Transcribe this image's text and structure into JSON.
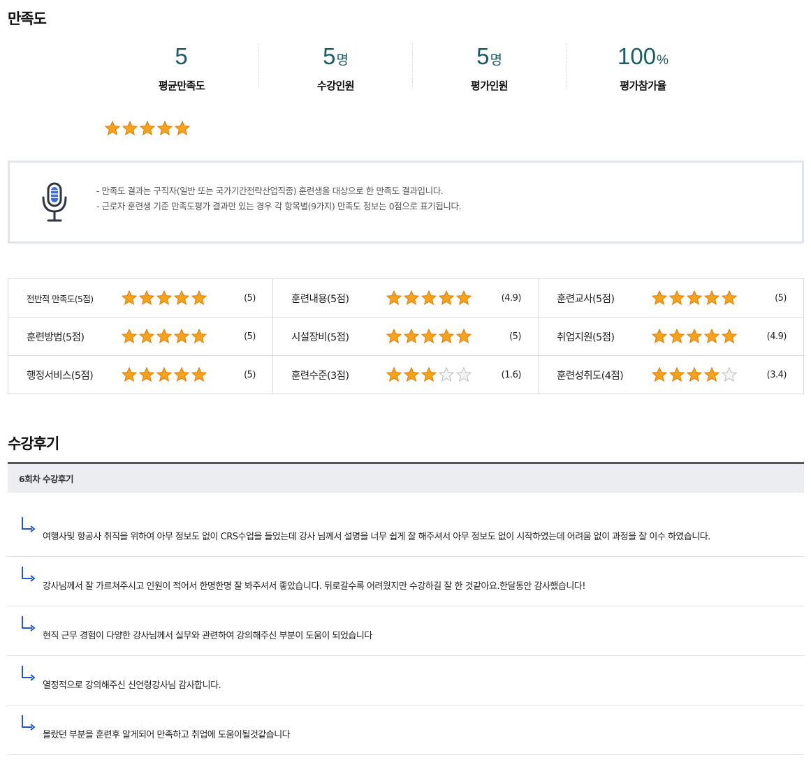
{
  "satisfaction": {
    "title": "만족도",
    "summary": [
      {
        "value": "5",
        "unit": "",
        "label": "평균만족도"
      },
      {
        "value": "5",
        "unit": "명",
        "label": "수강인원"
      },
      {
        "value": "5",
        "unit": "명",
        "label": "평가인원"
      },
      {
        "value": "100",
        "unit": "%",
        "label": "평가참가율"
      }
    ],
    "overall_stars": 5
  },
  "notice": {
    "icon": "microphone-icon",
    "lines": [
      "- 만족도 결과는 구직자(일반 또는 국가기간전략산업직종) 훈련생을 대상으로 한 만족도 결과입니다.",
      "- 근로자 훈련생 기준 만족도평가 결과만 있는 경우 각 항목별(9가지) 만족도 정보는 0점으로 표기됩니다."
    ]
  },
  "ratings": [
    {
      "label": "전반적 만족도(5점)",
      "max": 5,
      "score": 5,
      "score_text": "(5)"
    },
    {
      "label": "훈련내용(5점)",
      "max": 5,
      "score": 4.9,
      "score_text": "(4.9)"
    },
    {
      "label": "훈련교사(5점)",
      "max": 5,
      "score": 5,
      "score_text": "(5)"
    },
    {
      "label": "훈련방법(5점)",
      "max": 5,
      "score": 5,
      "score_text": "(5)"
    },
    {
      "label": "시설장비(5점)",
      "max": 5,
      "score": 5,
      "score_text": "(5)"
    },
    {
      "label": "취업지원(5점)",
      "max": 5,
      "score": 4.9,
      "score_text": "(4.9)"
    },
    {
      "label": "행정서비스(5점)",
      "max": 5,
      "score": 5,
      "score_text": "(5)"
    },
    {
      "label": "훈련수준(3점)",
      "max": 3,
      "score": 1.6,
      "score_text": "(1.6)"
    },
    {
      "label": "훈련성취도(4점)",
      "max": 4,
      "score": 3.4,
      "score_text": "(3.4)"
    }
  ],
  "reviews": {
    "title": "수강후기",
    "session_label": "6회차 수강후기",
    "items": [
      "여행사및 항공사 취직을 위하여 아무 정보도 없이 CRS수업을 들었는데 강사 님께서 설명을 너무 쉽게 잘 해주셔서 아무 정보도 없이 시작하였는데 어려움 없이 과정을 잘 이수 하였습니다.",
      "강사님께서 잘 가르쳐주시고 인원이 적어서 한명한명 잘 봐주셔서 좋았습니다. 뒤로갈수록 어려웠지만 수강하길 잘 한 것같아요.한달동안 감사했습니다!",
      "현직 근무 경험이 다양한 강사님께서 실무와 관련하여 강의해주신 부분이 도움이 되었습니다",
      "열정적으로 강의해주신 신언령강사님 감사합니다.",
      "몰랐던 부분을 훈련후 알게되어 만족하고 취업에 도움이될것같습니다"
    ]
  },
  "colors": {
    "accent_teal": "#1c5d63",
    "star_fill": "#f7a21b",
    "star_empty": "#d4d4d4",
    "arrow_blue": "#2255cc"
  }
}
